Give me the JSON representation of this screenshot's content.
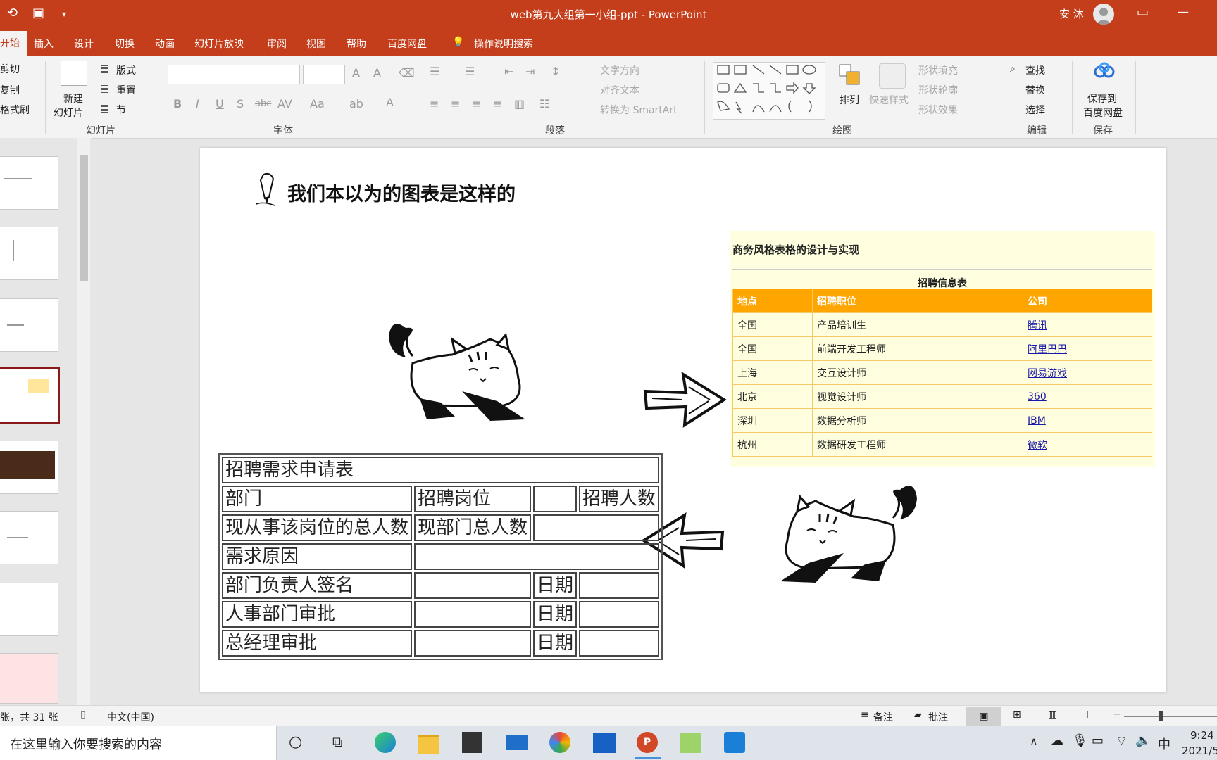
{
  "title_bar": {
    "document_title": "web第九大组第一小组-ppt  -  PowerPoint",
    "user_name": "安 沐",
    "minimize_glyph": "—",
    "restore_glyph": "▭"
  },
  "tabs": [
    {
      "label": "开始",
      "active": true
    },
    {
      "label": "插入"
    },
    {
      "label": "设计"
    },
    {
      "label": "切换"
    },
    {
      "label": "动画"
    },
    {
      "label": "幻灯片放映"
    },
    {
      "label": "审阅"
    },
    {
      "label": "视图"
    },
    {
      "label": "帮助"
    },
    {
      "label": "百度网盘"
    }
  ],
  "tell_me": "操作说明搜索",
  "ribbon": {
    "clipboard": {
      "cut": "剪切",
      "copy": "复制",
      "format_painter": "格式刷"
    },
    "slides": {
      "new_slide_1": "新建",
      "new_slide_2": "幻灯片",
      "layout": "版式",
      "reset": "重置",
      "section": "节",
      "group": "幻灯片"
    },
    "font": {
      "group": "字体",
      "bold": "B",
      "italic": "I",
      "underline": "U",
      "shadow": "S",
      "strike": "abc",
      "spacing": "AV",
      "case": "Aa"
    },
    "paragraph": {
      "group": "段落",
      "text_dir": "文字方向",
      "align_text": "对齐文本",
      "smartart": "转换为 SmartArt"
    },
    "drawing": {
      "group": "绘图",
      "arrange": "排列",
      "quick_styles": "快速样式",
      "fill": "形状填充",
      "outline": "形状轮廓",
      "effects": "形状效果"
    },
    "editing": {
      "group": "编辑",
      "find": "查找",
      "replace": "替换",
      "select": "选择"
    },
    "save": {
      "group": "保存",
      "line1": "保存到",
      "line2": "百度网盘"
    }
  },
  "slide": {
    "title": "我们本以为的图表是这样的",
    "form_table": {
      "title": "招聘需求申请表",
      "r1": [
        "部门",
        "招聘岗位",
        "招聘人数"
      ],
      "r2": [
        "现从事该岗位的总人数",
        "现部门总人数"
      ],
      "r3": [
        "需求原因"
      ],
      "r4": [
        "部门负责人签名",
        "日期"
      ],
      "r5": [
        "人事部门审批",
        "日期"
      ],
      "r6": [
        "总经理审批",
        "日期"
      ]
    },
    "biz_table": {
      "heading": "商务风格表格的设计与实现",
      "caption": "招聘信息表",
      "headers": [
        "地点",
        "招聘职位",
        "公司"
      ],
      "rows": [
        [
          "全国",
          "产品培训生",
          "腾讯"
        ],
        [
          "全国",
          "前端开发工程师",
          "阿里巴巴"
        ],
        [
          "上海",
          "交互设计师",
          "网易游戏"
        ],
        [
          "北京",
          "视觉设计师",
          "360"
        ],
        [
          "深圳",
          "数据分析师",
          "IBM"
        ],
        [
          "杭州",
          "数据研发工程师",
          "微软"
        ]
      ]
    }
  },
  "status": {
    "slide_count": "张，共 31 张",
    "language": "中文(中国)",
    "notes": "备注",
    "comments": "批注"
  },
  "taskbar": {
    "search_placeholder": "在这里输入你要搜索的内容",
    "time": "9:24",
    "date": "2021/5",
    "ime": "中"
  },
  "colors": {
    "accent": "#c43e1c",
    "table_header": "#ffa500",
    "table_bg": "#ffffe0"
  }
}
